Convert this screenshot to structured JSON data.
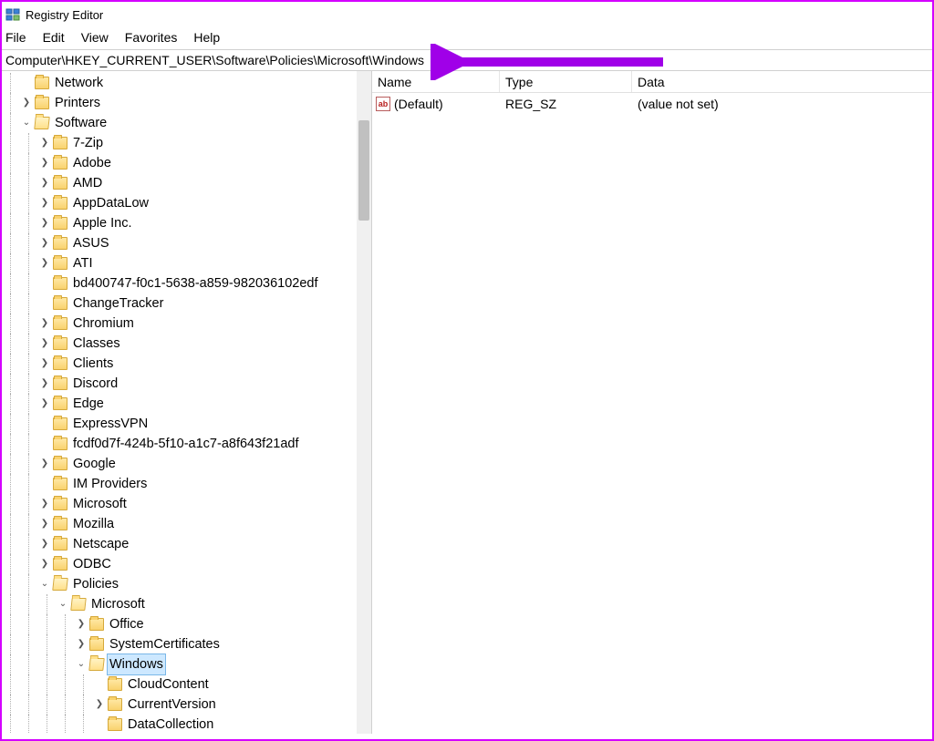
{
  "window": {
    "title": "Registry Editor"
  },
  "menu": {
    "file": "File",
    "edit": "Edit",
    "view": "View",
    "favorites": "Favorites",
    "help": "Help"
  },
  "address": "Computer\\HKEY_CURRENT_USER\\Software\\Policies\\Microsoft\\Windows",
  "tree": {
    "network": "Network",
    "printers": "Printers",
    "software": "Software",
    "software_children": {
      "sevenzip": "7-Zip",
      "adobe": "Adobe",
      "amd": "AMD",
      "appdatalow": "AppDataLow",
      "appleinc": "Apple Inc.",
      "asus": "ASUS",
      "ati": "ATI",
      "bd4": "bd400747-f0c1-5638-a859-982036102edf",
      "changetracker": "ChangeTracker",
      "chromium": "Chromium",
      "classes": "Classes",
      "clients": "Clients",
      "discord": "Discord",
      "edge": "Edge",
      "expressvpn": "ExpressVPN",
      "fcdf": "fcdf0d7f-424b-5f10-a1c7-a8f643f21adf",
      "google": "Google",
      "improviders": "IM Providers",
      "microsoft": "Microsoft",
      "mozilla": "Mozilla",
      "netscape": "Netscape",
      "odbc": "ODBC",
      "policies": "Policies",
      "policies_children": {
        "microsoft": "Microsoft",
        "microsoft_children": {
          "office": "Office",
          "systemcertificates": "SystemCertificates",
          "windows": "Windows",
          "windows_children": {
            "cloudcontent": "CloudContent",
            "currentversion": "CurrentVersion",
            "datacollection": "DataCollection"
          }
        }
      }
    }
  },
  "list": {
    "headers": {
      "name": "Name",
      "type": "Type",
      "data": "Data"
    },
    "rows": [
      {
        "name": "(Default)",
        "type": "REG_SZ",
        "data": "(value not set)"
      }
    ]
  },
  "annotation": {
    "color": "#a000e8"
  }
}
